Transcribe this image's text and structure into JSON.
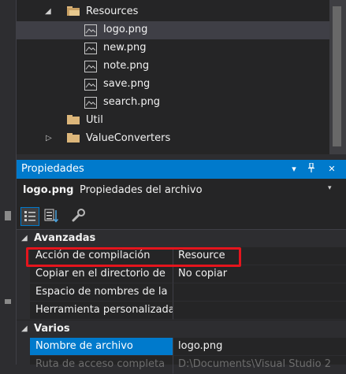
{
  "colors": {
    "accent": "#007acc",
    "highlight_box": "#e5151d",
    "folder": "#dcb67a",
    "background": "#252526"
  },
  "solution_explorer": {
    "items": [
      {
        "label": "Resources",
        "icon": "folder-open-icon",
        "expander": "◢"
      },
      {
        "label": "logo.png",
        "icon": "image-file-icon",
        "selected": true
      },
      {
        "label": "new.png",
        "icon": "image-file-icon"
      },
      {
        "label": "note.png",
        "icon": "image-file-icon"
      },
      {
        "label": "save.png",
        "icon": "image-file-icon"
      },
      {
        "label": "search.png",
        "icon": "image-file-icon"
      },
      {
        "label": "Util",
        "icon": "folder-icon"
      },
      {
        "label": "ValueConverters",
        "icon": "folder-icon",
        "expander": "▷"
      }
    ]
  },
  "properties": {
    "title": "Propiedades",
    "title_buttons": {
      "dropdown": "▾",
      "pin": "📌",
      "close": "✕"
    },
    "object_name": "logo.png",
    "object_type": "Propiedades del archivo",
    "object_dropdown": "▾",
    "categories": [
      {
        "label": "Avanzadas",
        "expander": "◢",
        "rows": [
          {
            "name": "Acción de compilación",
            "value": "Resource"
          },
          {
            "name": "Copiar en el directorio de",
            "value": "No copiar"
          },
          {
            "name": "Espacio de nombres de la",
            "value": ""
          },
          {
            "name": "Herramienta personalizada",
            "value": ""
          }
        ]
      },
      {
        "label": "Varios",
        "expander": "◢",
        "rows": [
          {
            "name": "Nombre de archivo",
            "value": "logo.png",
            "selected": true
          },
          {
            "name": "Ruta de acceso completa",
            "value": "D:\\Documents\\Visual Studio 2",
            "faded": true
          }
        ]
      }
    ]
  }
}
